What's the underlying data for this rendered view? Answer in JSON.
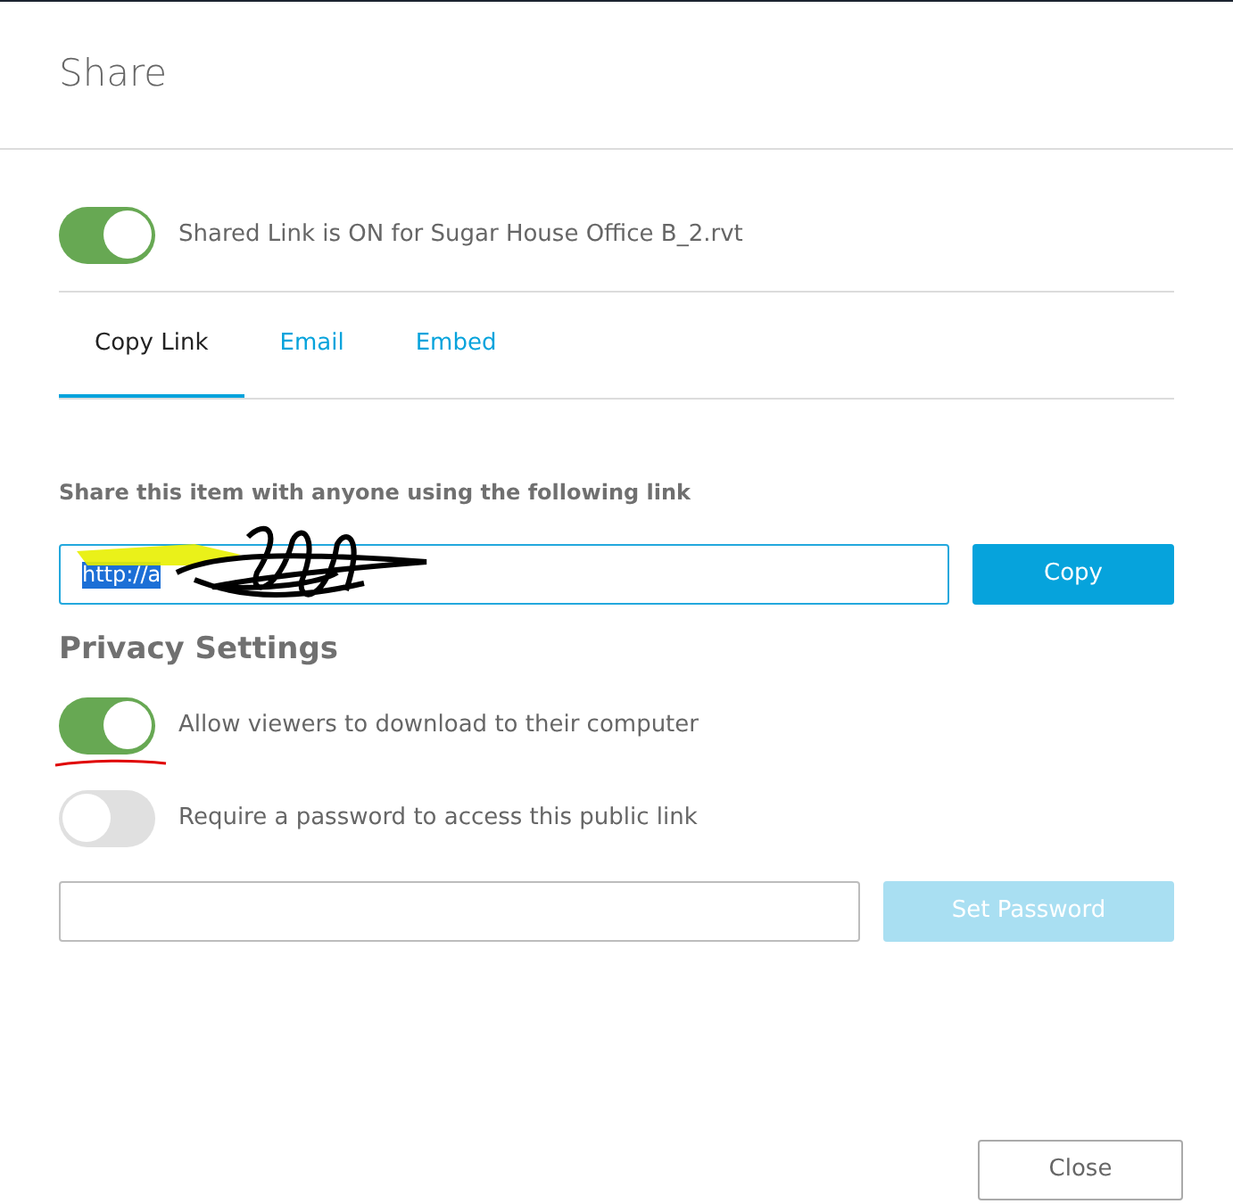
{
  "dialog": {
    "title": "Share"
  },
  "shared_link": {
    "on": true,
    "label": "Shared Link is ON for Sugar House Office B_2.rvt"
  },
  "tabs": [
    {
      "label": "Copy Link",
      "selected": true
    },
    {
      "label": "Email",
      "selected": false
    },
    {
      "label": "Embed",
      "selected": false
    }
  ],
  "link_section": {
    "label": "Share this item with anyone using the following link",
    "value": "http://a",
    "copy_button": "Copy"
  },
  "privacy": {
    "heading": "Privacy Settings",
    "options": [
      {
        "label": "Allow viewers to download to their computer",
        "on": true
      },
      {
        "label": "Require a password to access this public link",
        "on": false
      }
    ],
    "password_button": {
      "label": "Set Password",
      "disabled": true
    }
  },
  "close_button": "Close"
}
